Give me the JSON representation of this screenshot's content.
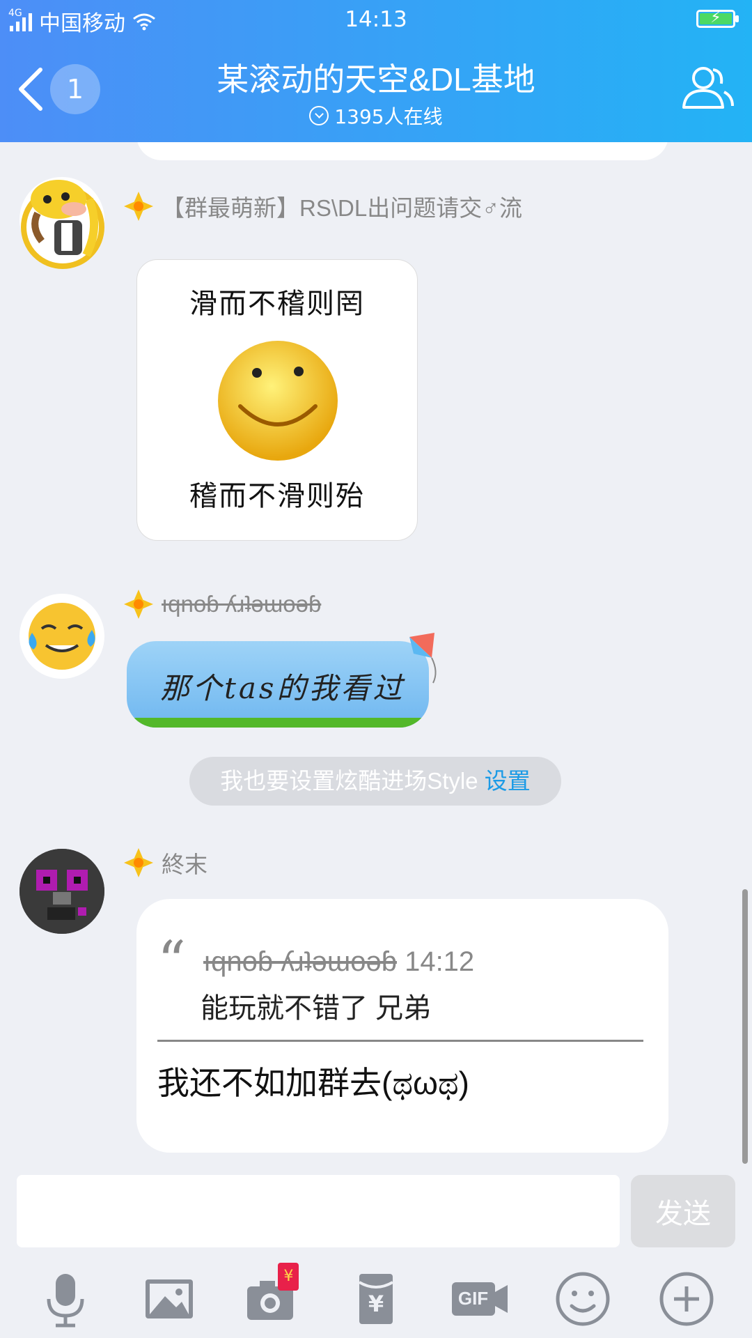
{
  "status_bar": {
    "network_tag": "4G",
    "carrier": "中国移动",
    "time": "14:13"
  },
  "header": {
    "unread_count": "1",
    "title": "某滚动的天空&DL基地",
    "online_text": "1395人在线"
  },
  "messages": [
    {
      "nickname": "【群最萌新】RS\\DL出问题请交♂流",
      "sticker_top": "滑而不稽则罔",
      "sticker_bottom": "稽而不滑则殆"
    },
    {
      "nickname": "ıqnoɓ ʎɹʇǝɯoǝɓ",
      "text": "那个tas的我看过"
    },
    {
      "nickname": "終末",
      "quote_author": "ıqnoɓ ʎɹʇǝɯoǝɓ",
      "quote_time": "14:12",
      "quote_text": "能玩就不错了 兄弟",
      "text": "我还不如加群去(ಥωಥ)"
    }
  ],
  "system_notice": {
    "text": "我也要设置炫酷进场Style",
    "link": "设置"
  },
  "input": {
    "placeholder": "",
    "send_label": "发送"
  },
  "toolbar": {
    "items": [
      "microphone-icon",
      "image-icon",
      "camera-redpacket-icon",
      "redpacket-icon",
      "gif-icon",
      "emoji-icon",
      "plus-icon"
    ],
    "redpacket_badge": "¥",
    "gif_label": "GIF",
    "money_symbol": "¥"
  },
  "colors": {
    "header_start": "#4d8ef7",
    "header_end": "#23b3f5",
    "link": "#1c9be6",
    "background": "#eef0f5"
  }
}
